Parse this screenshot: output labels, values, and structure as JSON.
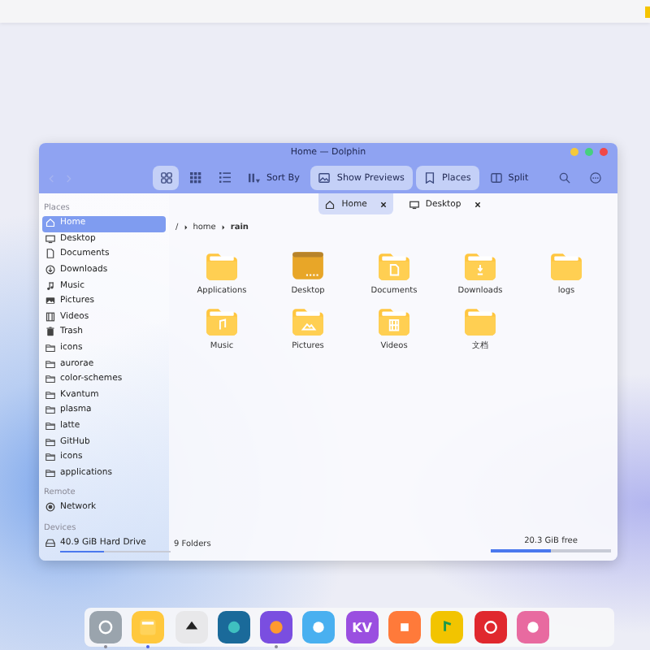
{
  "window": {
    "title": "Home — Dolphin"
  },
  "toolbar": {
    "view_modes": [
      {
        "kind": "icons",
        "selected": true
      },
      {
        "kind": "compact",
        "selected": false
      },
      {
        "kind": "details",
        "selected": false
      }
    ],
    "buttons": [
      {
        "kind": "sort",
        "label": "Sort By",
        "on": false
      },
      {
        "kind": "previews",
        "label": "Show Previews",
        "on": true
      },
      {
        "kind": "places",
        "label": "Places",
        "on": true
      },
      {
        "kind": "split",
        "label": "Split",
        "on": false
      }
    ]
  },
  "tabs": [
    {
      "label": "Home",
      "kind": "home",
      "selected": true
    },
    {
      "label": "Desktop",
      "kind": "desktop",
      "selected": false
    }
  ],
  "sidebar": {
    "sections": [
      {
        "heading": "Places",
        "items": [
          {
            "label": "Home",
            "kind": "home",
            "selected": true
          },
          {
            "label": "Desktop",
            "kind": "desktop",
            "selected": false
          },
          {
            "label": "Documents",
            "kind": "documents",
            "selected": false
          },
          {
            "label": "Downloads",
            "kind": "downloads",
            "selected": false
          },
          {
            "label": "Music",
            "kind": "music",
            "selected": false
          },
          {
            "label": "Pictures",
            "kind": "pictures",
            "selected": false
          },
          {
            "label": "Videos",
            "kind": "videos",
            "selected": false
          },
          {
            "label": "Trash",
            "kind": "trash",
            "selected": false
          },
          {
            "label": "icons",
            "kind": "folder",
            "selected": false
          },
          {
            "label": "aurorae",
            "kind": "folder",
            "selected": false
          },
          {
            "label": "color-schemes",
            "kind": "folder",
            "selected": false
          },
          {
            "label": "Kvantum",
            "kind": "folder",
            "selected": false
          },
          {
            "label": "plasma",
            "kind": "folder",
            "selected": false
          },
          {
            "label": "latte",
            "kind": "folder",
            "selected": false
          },
          {
            "label": "GitHub",
            "kind": "folder",
            "selected": false
          },
          {
            "label": "icons",
            "kind": "folder",
            "selected": false
          },
          {
            "label": "applications",
            "kind": "folder",
            "selected": false
          }
        ]
      },
      {
        "heading": "Remote",
        "items": [
          {
            "label": "Network",
            "kind": "network",
            "selected": false
          }
        ]
      },
      {
        "heading": "Devices",
        "items": [
          {
            "label": "40.9 GiB Hard Drive",
            "kind": "drive",
            "selected": false,
            "level": 0.4
          }
        ]
      }
    ]
  },
  "breadcrumb": [
    "/",
    "home",
    "rain"
  ],
  "files": [
    {
      "name": "Applications",
      "kind": "folder"
    },
    {
      "name": "Desktop",
      "kind": "desktop"
    },
    {
      "name": "Documents",
      "kind": "documents"
    },
    {
      "name": "Downloads",
      "kind": "downloads"
    },
    {
      "name": "logs",
      "kind": "folder"
    },
    {
      "name": "Music",
      "kind": "music"
    },
    {
      "name": "Pictures",
      "kind": "pictures"
    },
    {
      "name": "Videos",
      "kind": "videos"
    },
    {
      "name": "文档",
      "kind": "folder"
    }
  ],
  "status_bar": {
    "summary": "9 Folders",
    "free": "20.3 GiB free",
    "level": 0.5
  },
  "dock": [
    {
      "kind": "settings",
      "color": "#9aa4ad",
      "running": true,
      "selected": false
    },
    {
      "kind": "files",
      "color": "#ffc83d",
      "running": true,
      "selected": true
    },
    {
      "kind": "inkscape",
      "color": "#e8e8ea",
      "running": false,
      "selected": false
    },
    {
      "kind": "browser",
      "color": "#1a6a9a",
      "running": false,
      "selected": false
    },
    {
      "kind": "firefox",
      "color": "#7a4ee0",
      "running": true,
      "selected": false
    },
    {
      "kind": "github",
      "color": "#49b0f0",
      "running": false,
      "selected": false
    },
    {
      "kind": "text",
      "label": "KV",
      "color": "#9a4fe0",
      "running": false,
      "selected": false
    },
    {
      "kind": "shop",
      "color": "#ff7a3a",
      "running": false,
      "selected": false
    },
    {
      "kind": "music",
      "color": "#f2c400",
      "running": false,
      "selected": false
    },
    {
      "kind": "netease",
      "color": "#e0282e",
      "running": false,
      "selected": false
    },
    {
      "kind": "chrome",
      "color": "#e86aa0",
      "running": false,
      "selected": false
    }
  ]
}
